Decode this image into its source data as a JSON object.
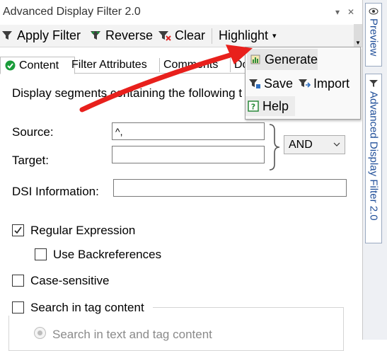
{
  "window": {
    "title": "Advanced Display Filter 2.0",
    "pin_glyph": "▾",
    "close_glyph": "✕"
  },
  "toolbar": {
    "apply_filter": "Apply Filter",
    "reverse": "Reverse",
    "clear": "Clear",
    "highlight": "Highlight",
    "highlight_arrow": "▾"
  },
  "tabs": {
    "content": "Content",
    "filter_attributes": "Filter Attributes",
    "comments": "Comments",
    "more": "Do"
  },
  "menu": {
    "generate": "Generate",
    "save": "Save",
    "import": "Import",
    "help": "Help"
  },
  "content": {
    "intro": "Display segments containing the following t",
    "source_label": "Source:",
    "source_value": "^,",
    "target_label": "Target:",
    "target_value": "",
    "operator": "AND",
    "dsi_label": "DSI Information:",
    "dsi_value": "",
    "regex_label": "Regular Expression",
    "regex_checked": true,
    "backref_label": "Use Backreferences",
    "case_label": "Case-sensitive",
    "tag_label": "Search in tag content",
    "tag_option": "Search in text and tag content"
  },
  "sidebar": {
    "preview": "Preview",
    "adf": "Advanced Display Filter 2.0"
  },
  "colors": {
    "arrow": "#e8201c",
    "vtab_text": "#1f4e99",
    "check_green": "#1a9c3a"
  }
}
